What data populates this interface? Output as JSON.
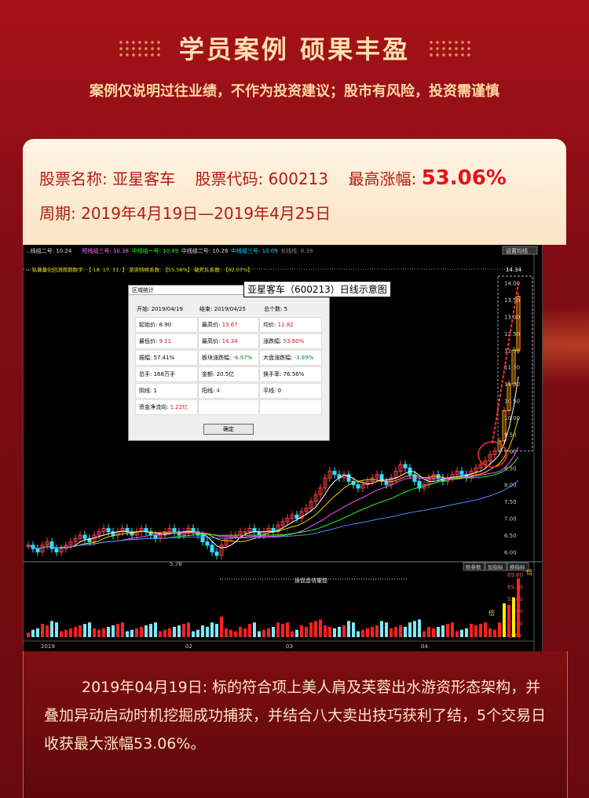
{
  "header": {
    "title": "学员案例 硕果丰盈",
    "disclaimer": "案例仅说明过往业绩，不作为投资建议；股市有风险，投资需谨慎"
  },
  "stock": {
    "name_label": "股票名称:",
    "name": "亚星客车",
    "code_label": "股票代码:",
    "code": "600213",
    "gain_label": "最高涨幅:",
    "gain": "53.06%",
    "period_label": "周期:",
    "period": "2019年4月19日—2019年4月25日"
  },
  "chart_header": {
    "ma_items": [
      "...线组二号: 10.24",
      "短线组三号: 10.38",
      "中线组一号: 10.49",
      "中线组二号: 10.26",
      "中线组三号: 10.09",
      "长线线: 8.39"
    ],
    "signal_line": "— 私募量化回测周期数字: 【 18.  17.  11.  】  游资持续系数: 【55.56%】  敏死队系数: 【62.07%】",
    "settings_button": "设置均线",
    "stock_label": "亚星客车（600213）日线示意图",
    "peak_value": "14.34",
    "low_value": "5.78",
    "indicator_tabs": [
      "欧参数",
      "加指标",
      "换指标"
    ],
    "volume_label": "操盘虚倍量能",
    "dates": [
      "2019",
      "02",
      "03",
      "04"
    ],
    "multiplier": "倍",
    "price_ticks": [
      "14.00",
      "13.50",
      "13.00",
      "12.50",
      "12.00",
      "11.50",
      "11.00",
      "10.50",
      "10.00",
      "9.50",
      "9.00",
      "8.50",
      "8.00",
      "7.50",
      "7.00",
      "6.50",
      "6.00"
    ],
    "volume_ticks": [
      "89.60",
      "69.80",
      "53.00",
      "33.90",
      "15.90",
      "-2.69"
    ]
  },
  "dialog": {
    "title": "区域统计",
    "start_label": "开始:",
    "start": "2019/04/19",
    "end_label": "结束:",
    "end": "2019/04/25",
    "count_label": "总个数:",
    "count": "5",
    "rows": [
      [
        [
          "起始价:",
          "8.90",
          ""
        ],
        [
          "最高价:",
          "13.67",
          "red"
        ],
        [
          "均价:",
          "11.82",
          "red"
        ]
      ],
      [
        [
          "最低价:",
          "9.11",
          "red"
        ],
        [
          "最高价:",
          "14.34",
          "red"
        ],
        [
          "涨跌幅:",
          "53.60%",
          "red"
        ]
      ],
      [
        [
          "振幅:",
          "57.41%",
          ""
        ],
        [
          "板块涨跌幅:",
          "-6.97%",
          "green"
        ],
        [
          "大盘涨跌幅:",
          "-3.89%",
          "green"
        ]
      ],
      [
        [
          "总手:",
          "168万手",
          ""
        ],
        [
          "金额:",
          "20.5亿",
          ""
        ],
        [
          "换手率:",
          "76.56%",
          ""
        ]
      ],
      [
        [
          "阴线:",
          "1",
          ""
        ],
        [
          "阳线:",
          "4",
          "red"
        ],
        [
          "平线:",
          "0",
          ""
        ]
      ],
      [
        [
          "资金净流向:",
          "1.22亿",
          "red"
        ],
        [
          "",
          "",
          ""
        ],
        [
          "",
          "",
          ""
        ]
      ]
    ],
    "ok": "确定"
  },
  "description": "2019年04月19日: 标的符合项上美人肩及芙蓉出水游资形态架构，并叠加异动启动时机挖掘成功捕获，并结合八大卖出技巧获利了结，5个交易日收获最大涨幅53.06%。",
  "colors": {
    "accent": "#e8101a",
    "gold": "#ffe2b0",
    "bg": "#8a0d14"
  }
}
